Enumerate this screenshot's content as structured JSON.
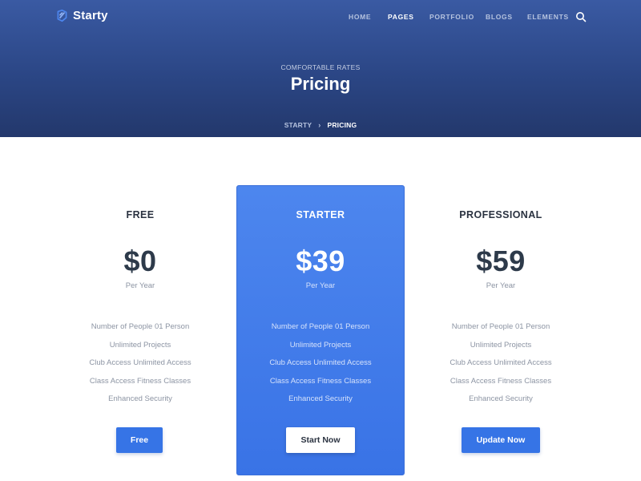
{
  "brand": {
    "name": "Starty"
  },
  "nav": {
    "items": [
      {
        "label": "HOME"
      },
      {
        "label": "PAGES"
      },
      {
        "label": "PORTFOLIO"
      },
      {
        "label": "BLOGS"
      },
      {
        "label": "ELEMENTS"
      }
    ],
    "active": "PAGES",
    "search_icon": "search-icon"
  },
  "hero": {
    "eyebrow": "COMFORTABLE RATES",
    "title": "Pricing",
    "breadcrumb": {
      "home": "STARTY",
      "separator": "›",
      "current": "PRICING"
    }
  },
  "plans": [
    {
      "name": "FREE",
      "price": "$0",
      "period": "Per Year",
      "features": [
        "Number of People 01 Person",
        "Unlimited Projects",
        "Club Access Unlimited Access",
        "Class Access Fitness Classes",
        "Enhanced Security"
      ],
      "button": "Free"
    },
    {
      "name": "STARTER",
      "price": "$39",
      "period": "Per Year",
      "features": [
        "Number of People 01 Person",
        "Unlimited Projects",
        "Club Access Unlimited Access",
        "Class Access Fitness Classes",
        "Enhanced Security"
      ],
      "button": "Start Now"
    },
    {
      "name": "PROFESSIONAL",
      "price": "$59",
      "period": "Per Year",
      "features": [
        "Number of People 01 Person",
        "Unlimited Projects",
        "Club Access Unlimited Access",
        "Class Access Fitness Classes",
        "Enhanced Security"
      ],
      "button": "Update Now"
    }
  ],
  "colors": {
    "hero_top": "#3a5aa3",
    "hero_bottom": "#23386c",
    "accent": "#3674e6",
    "featured_card": "#4379ea",
    "text_dark": "#2d3a4a",
    "text_muted": "#8c94a3"
  }
}
